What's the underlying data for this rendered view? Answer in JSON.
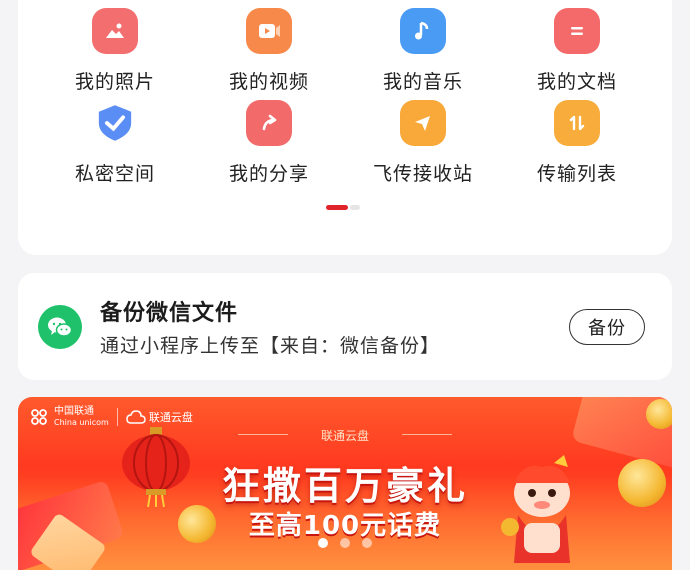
{
  "grid": {
    "items": [
      {
        "label": "我的照片",
        "icon": "photo-icon",
        "color": "#f36f6f"
      },
      {
        "label": "我的视频",
        "icon": "video-icon",
        "color": "#f7894a"
      },
      {
        "label": "我的音乐",
        "icon": "music-icon",
        "color": "#4a9bf3"
      },
      {
        "label": "我的文档",
        "icon": "document-icon",
        "color": "#f46a6a"
      },
      {
        "label": "私密空间",
        "icon": "shield-check-icon",
        "color": "#5b8ef4"
      },
      {
        "label": "我的分享",
        "icon": "share-arrow-icon",
        "color": "#f26a6a"
      },
      {
        "label": "飞传接收站",
        "icon": "paper-plane-icon",
        "color": "#f8a93a"
      },
      {
        "label": "传输列表",
        "icon": "transfer-arrows-icon",
        "color": "#f7ac3c"
      }
    ]
  },
  "backup": {
    "title": "备份微信文件",
    "subtitle": "通过小程序上传至【来自：微信备份】",
    "button": "备份",
    "icon": "wechat-icon",
    "accent": "#1fc26b"
  },
  "banner": {
    "brand_cn": "中国联通",
    "brand_en": "China unicom",
    "cloud_brand": "联通云盘",
    "tagline": "联通云盘",
    "headline": "狂撒百万豪礼",
    "subline": "至高100元话费",
    "page_count": 3,
    "active_page": 1
  }
}
